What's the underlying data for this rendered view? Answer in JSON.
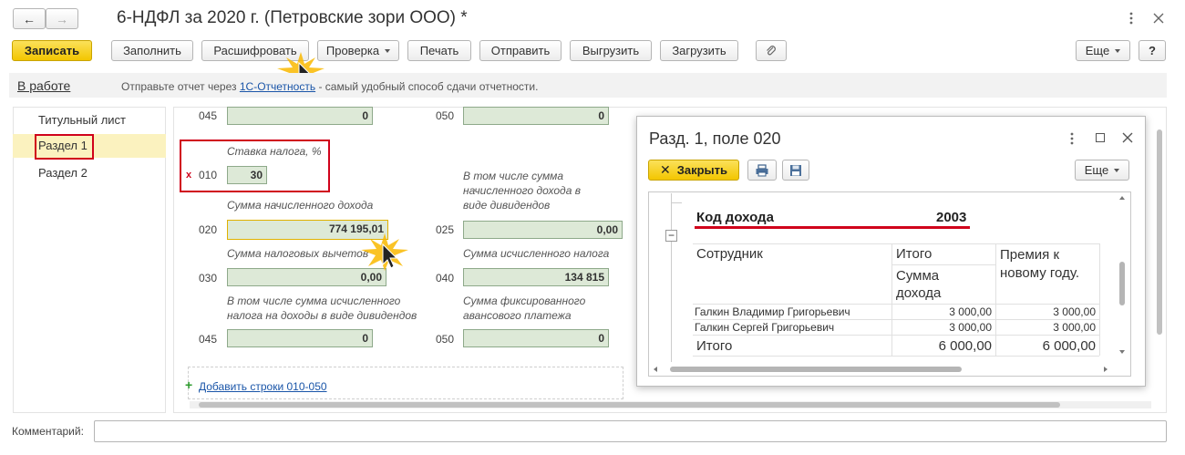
{
  "window": {
    "title": "6-НДФЛ за 2020 г. (Петровские зори ООО) *",
    "nav_back": "←",
    "nav_forward": "→"
  },
  "toolbar": {
    "save": "Записать",
    "fill": "Заполнить",
    "decode": "Расшифровать",
    "check": "Проверка",
    "print": "Печать",
    "send": "Отправить",
    "export": "Выгрузить",
    "import": "Загрузить",
    "more": "Еще",
    "help": "?"
  },
  "status": {
    "state": "В работе",
    "text_before": "Отправьте отчет через",
    "link": "1С-Отчетность",
    "text_after": "- самый удобный способ сдачи отчетности."
  },
  "sidebar": {
    "items": [
      {
        "label": "Титульный лист"
      },
      {
        "label": "Раздел 1"
      },
      {
        "label": "Раздел 2"
      }
    ]
  },
  "form": {
    "row045_top": {
      "code": "045",
      "value": "0"
    },
    "row050_top": {
      "code": "050",
      "value": "0"
    },
    "tax_rate_label": "Ставка налога, %",
    "row010": {
      "mark": "x",
      "code": "010",
      "value": "30"
    },
    "income_label": "Сумма начисленного дохода",
    "dividends_label": "В том числе сумма начисленного дохода в виде дивидендов",
    "row020": {
      "code": "020",
      "value": "774 195,01"
    },
    "row025": {
      "code": "025",
      "value": "0,00"
    },
    "deductions_label": "Сумма налоговых вычетов",
    "calc_tax_label": "Сумма исчисленного налога",
    "row030": {
      "code": "030",
      "value": "0,00"
    },
    "row040": {
      "code": "040",
      "value": "134 815"
    },
    "div_tax_label": "В том числе сумма исчисленного налога на доходы в виде дивидендов",
    "fixed_adv_label": "Сумма фиксированного авансового платежа",
    "row045": {
      "code": "045",
      "value": "0"
    },
    "row050": {
      "code": "050",
      "value": "0"
    },
    "add_rows": "Добавить строки 010-050",
    "add_icon": "+"
  },
  "comment": {
    "label": "Комментарий:"
  },
  "popup": {
    "title": "Разд. 1, поле 020",
    "close_label": "Закрыть",
    "more": "Еще",
    "income_code_label": "Код дохода",
    "income_code_value": "2003",
    "collapse_icon": "−",
    "table": {
      "col_employee": "Сотрудник",
      "col_total": "Итого",
      "col_total_sub": "Сумма дохода",
      "col_bonus": "Премия к новому году.",
      "rows": [
        {
          "name": "Галкин Владимир Григорьевич",
          "total": "3 000,00",
          "bonus": "3 000,00"
        },
        {
          "name": "Галкин Сергей Григорьевич",
          "total": "3 000,00",
          "bonus": "3 000,00"
        }
      ],
      "footer": {
        "name": "Итого",
        "total": "6 000,00",
        "bonus": "6 000,00"
      }
    }
  },
  "colors": {
    "accent_yellow": "#f3c600",
    "field_green": "#dde9d7",
    "highlight_red": "#d0021b",
    "link_blue": "#1a55a8"
  }
}
